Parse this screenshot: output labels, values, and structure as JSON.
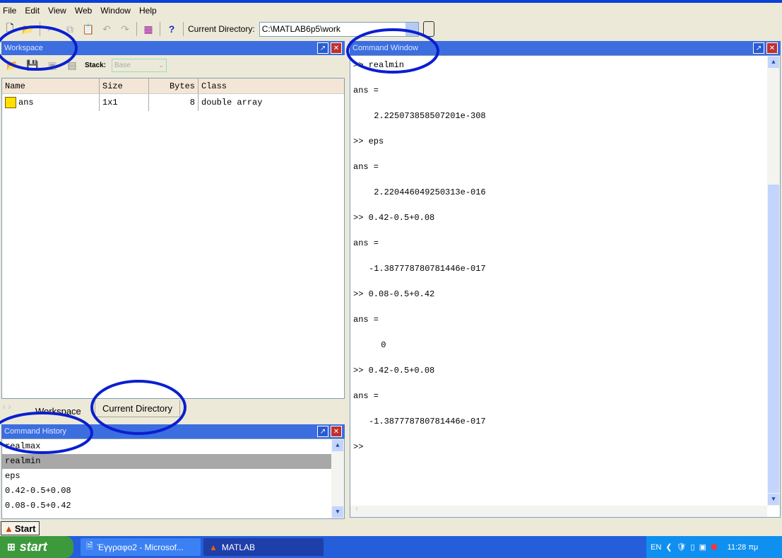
{
  "menu": [
    "File",
    "Edit",
    "View",
    "Web",
    "Window",
    "Help"
  ],
  "toolbar": {
    "current_directory_label": "Current Directory:",
    "current_directory_value": "C:\\MATLAB6p5\\work"
  },
  "workspace": {
    "title": "Workspace",
    "stack_label": "Stack:",
    "stack_value": "Base",
    "columns": [
      "Name",
      "Size",
      "Bytes",
      "Class"
    ],
    "rows": [
      {
        "name": "ans",
        "size": "1x1",
        "bytes": "8",
        "class": "double array"
      }
    ]
  },
  "tabs": [
    "Workspace",
    "Current Directory"
  ],
  "history": {
    "title": "Command History",
    "items": [
      "realmax",
      "realmin",
      "eps",
      "0.42-0.5+0.08",
      "0.08-0.5+0.42"
    ],
    "selected": "realmin"
  },
  "command": {
    "title": "Command Window",
    "lines": [
      ">> realmin",
      "",
      "ans =",
      "",
      " 2.225073858507201e-308",
      "",
      ">> eps",
      "",
      "ans =",
      "",
      " 2.220446049250313e-016",
      "",
      ">> 0.42-0.5+0.08",
      "",
      "ans =",
      "",
      "-1.387778780781446e-017",
      "",
      ">> 0.08-0.5+0.42",
      "",
      "ans =",
      "",
      " 0",
      "",
      ">> 0.42-0.5+0.08",
      "",
      "ans =",
      "",
      "-1.387778780781446e-017",
      "",
      ">>"
    ]
  },
  "startbar": {
    "start_label": "Start"
  },
  "taskbar": {
    "start": "start",
    "tasks": [
      "Έγγραφο2 - Microsof...",
      "MATLAB"
    ],
    "lang": "EN",
    "clock": "11:28 πμ"
  },
  "colors": {
    "title_bar": "#3c6ee0",
    "annotation": "#0a1fd0",
    "taskbar": "#245edb"
  }
}
